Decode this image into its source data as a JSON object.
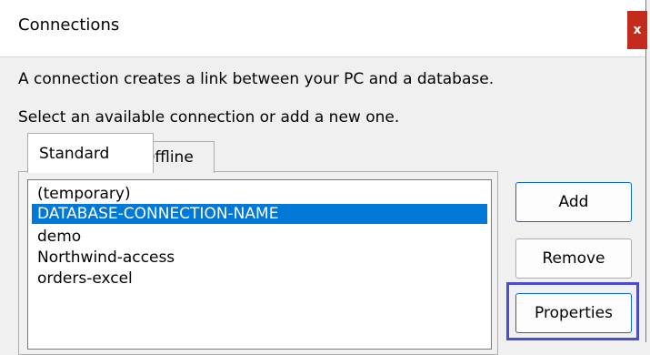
{
  "window": {
    "title": "Connections",
    "close_label": "x"
  },
  "description": {
    "line1": "A connection creates a link between your PC and a database.",
    "line2": "Select an available connection or add a new one."
  },
  "tabs": [
    {
      "label": "Standard",
      "active": true
    },
    {
      "label": "Offline",
      "active": false
    }
  ],
  "connections": {
    "items": [
      {
        "label": "(temporary)"
      },
      {
        "label": "DATABASE-CONNECTION-NAME",
        "selected": true
      },
      {
        "label": "demo"
      },
      {
        "label": "Northwind-access"
      },
      {
        "label": "orders-excel"
      }
    ]
  },
  "buttons": {
    "add": "Add",
    "remove": "Remove",
    "properties": "Properties"
  },
  "colors": {
    "selection": "#0078d7",
    "close": "#c42b1c",
    "focus": "#4a4ecc"
  }
}
